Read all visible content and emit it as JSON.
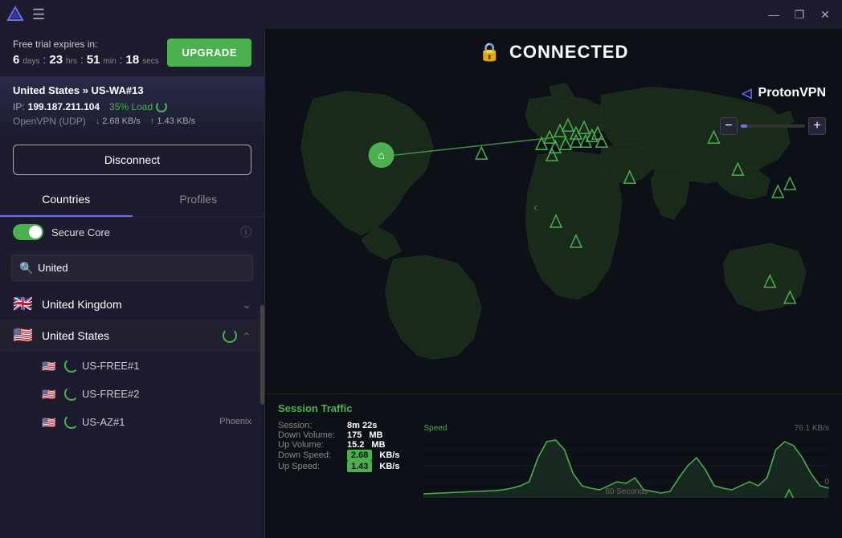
{
  "titlebar": {
    "minimize_label": "—",
    "maximize_label": "❐",
    "close_label": "✕"
  },
  "trial": {
    "label": "Free trial expires in:",
    "days_num": "6",
    "days_label": "days",
    "hrs_num": "23",
    "hrs_label": "hrs",
    "min_num": "51",
    "min_label": "min",
    "secs_num": "18",
    "secs_label": "secs",
    "upgrade_label": "UPGRADE"
  },
  "connection": {
    "country": "United States",
    "server": "US-WA#13",
    "ip_label": "IP:",
    "ip": "199.187.211.104",
    "load": "35% Load",
    "protocol": "OpenVPN (UDP)",
    "down_speed": "2.68 KB/s",
    "up_speed": "1.43 KB/s",
    "disconnect_label": "Disconnect"
  },
  "tabs": {
    "countries_label": "Countries",
    "profiles_label": "Profiles"
  },
  "search": {
    "placeholder": "United",
    "value": "United"
  },
  "secure_core": {
    "label": "Secure Core",
    "enabled": true
  },
  "countries": [
    {
      "name": "United Kingdom",
      "flag": "🇬🇧",
      "expanded": false
    },
    {
      "name": "United States",
      "flag": "🇺🇸",
      "expanded": true,
      "servers": [
        {
          "name": "US-FREE#1"
        },
        {
          "name": "US-FREE#2"
        },
        {
          "name": "US-AZ#1",
          "location": "Phoenix"
        }
      ]
    }
  ],
  "header": {
    "connected_label": "CONNECTED",
    "brand_label": "ProtonVPN"
  },
  "zoom": {
    "minus_label": "−",
    "plus_label": "+"
  },
  "traffic": {
    "title": "Session Traffic",
    "session_label": "Session:",
    "session_value": "8m 22s",
    "down_vol_label": "Down Volume:",
    "down_vol_value": "175",
    "down_vol_unit": "MB",
    "up_vol_label": "Up Volume:",
    "up_vol_value": "15.2",
    "up_vol_unit": "MB",
    "down_speed_label": "Down Speed:",
    "down_speed_value": "2.68",
    "down_speed_unit": "KB/s",
    "up_speed_label": "Up Speed:",
    "up_speed_value": "1.43",
    "up_speed_unit": "KB/s",
    "chart_speed_label": "Speed",
    "chart_max_label": "76.1  KB/s",
    "chart_zero_label": "0",
    "chart_time_label": "60 Seconds",
    "colors": {
      "accent": "#4caf50"
    }
  }
}
